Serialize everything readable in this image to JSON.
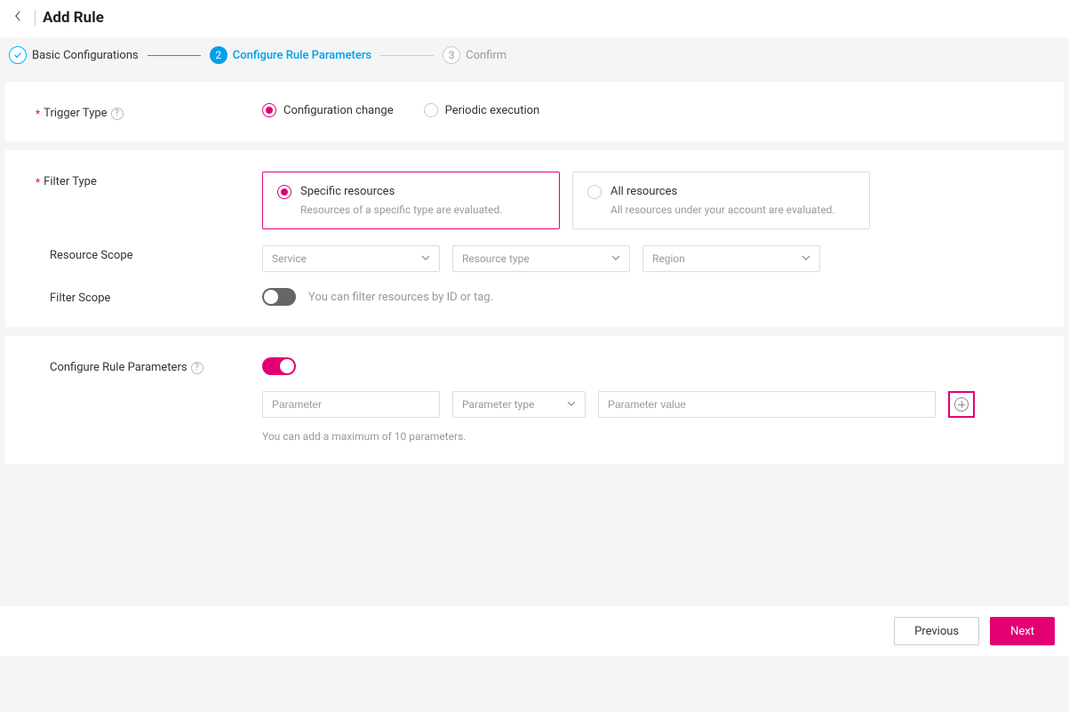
{
  "header": {
    "title": "Add Rule"
  },
  "stepper": {
    "step1": "Basic Configurations",
    "step2": "Configure Rule Parameters",
    "step3": "Confirm",
    "step3_num": "3"
  },
  "trigger": {
    "label": "Trigger Type",
    "opt_config_change": "Configuration change",
    "opt_periodic": "Periodic execution"
  },
  "filter": {
    "label": "Filter Type",
    "specific_title": "Specific resources",
    "specific_desc": "Resources of a specific type are evaluated.",
    "all_title": "All resources",
    "all_desc": "All resources under your account are evaluated."
  },
  "resource_scope": {
    "label": "Resource Scope",
    "service_ph": "Service",
    "type_ph": "Resource type",
    "region_ph": "Region"
  },
  "filter_scope": {
    "label": "Filter Scope",
    "hint": "You can filter resources by ID or tag."
  },
  "params": {
    "label": "Configure Rule Parameters",
    "param_ph": "Parameter",
    "type_ph": "Parameter type",
    "value_ph": "Parameter value",
    "note": "You can add a maximum of 10 parameters."
  },
  "footer": {
    "prev": "Previous",
    "next": "Next"
  }
}
